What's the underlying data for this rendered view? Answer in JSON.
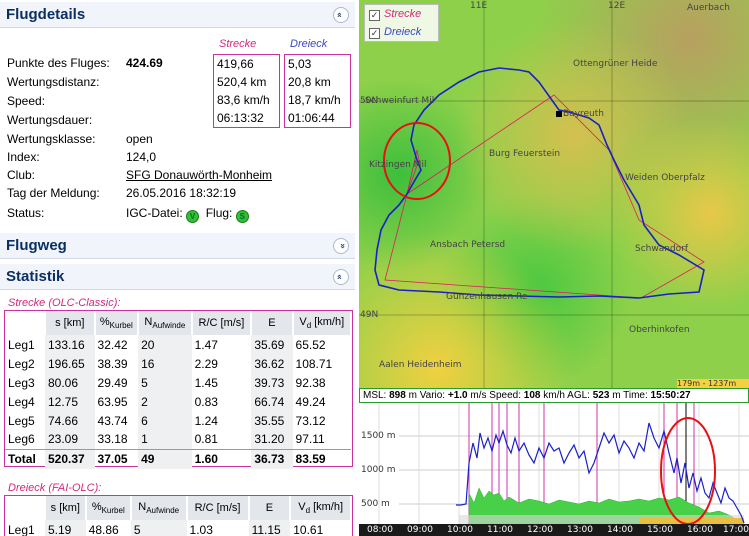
{
  "sections": {
    "flugdetails": "Flugdetails",
    "flugweg": "Flugweg",
    "statistik": "Statistik",
    "toggle_up": "»",
    "toggle_down": "»"
  },
  "details": {
    "labels": [
      "Punkte des Fluges:",
      "Wertungsdistanz:",
      "Speed:",
      "Wertungsdauer:",
      "Wertungsklasse:",
      "Index:",
      "Club:",
      "Tag der Meldung:",
      "Status:"
    ],
    "punkte": "424.69",
    "wertungsklasse": "open",
    "index": "124,0",
    "club": "SFG Donauwörth-Monheim",
    "tag": "26.05.2016 18:32:19",
    "igc_label": "IGC-Datei:",
    "flug_label": "Flug:",
    "igc_icon": "V",
    "flug_icon": "S"
  },
  "strecke": {
    "header": "Strecke",
    "values": [
      "419,66",
      "520,4 km",
      "83,6 km/h",
      "06:13:32"
    ]
  },
  "dreieck": {
    "header": "Dreieck",
    "values": [
      "5,03",
      "20,8 km",
      "18,7 km/h",
      "01:06:44"
    ]
  },
  "stats_olc": {
    "title": "Strecke (OLC-Classic):",
    "headers": [
      "",
      "s [km]",
      "%Kurbel",
      "NAufwinde",
      "R/C [m/s]",
      "E",
      "Vd [km/h]"
    ],
    "rows": [
      [
        "Leg1",
        "133.16",
        "32.42",
        "20",
        "1.47",
        "35.69",
        "65.52"
      ],
      [
        "Leg2",
        "196.65",
        "38.39",
        "16",
        "2.29",
        "36.62",
        "108.71"
      ],
      [
        "Leg3",
        "80.06",
        "29.49",
        "5",
        "1.45",
        "39.73",
        "92.38"
      ],
      [
        "Leg4",
        "12.75",
        "63.95",
        "2",
        "0.83",
        "66.74",
        "49.24"
      ],
      [
        "Leg5",
        "74.66",
        "43.74",
        "6",
        "1.24",
        "35.55",
        "73.12"
      ],
      [
        "Leg6",
        "23.09",
        "33.18",
        "1",
        "0.81",
        "31.20",
        "97.11"
      ]
    ],
    "total": [
      "Total",
      "520.37",
      "37.05",
      "49",
      "1.60",
      "36.73",
      "83.59"
    ]
  },
  "stats_fai": {
    "title": "Dreieck (FAI-OLC):",
    "rows": [
      [
        "Leg1",
        "5.19",
        "48.86",
        "5",
        "1.03",
        "11.15",
        "10.61"
      ]
    ]
  },
  "map": {
    "legend": [
      "Strecke",
      "Dreieck"
    ],
    "checkmark": "✓",
    "labels": {
      "grid11e": "11E",
      "grid12e": "12E",
      "grid50n": "50N",
      "grid49n": "49N",
      "auerbach": "Auerbach",
      "ottengruener": "Ottengrüner Heide",
      "schweinfurt": "Schweinfurt Mil",
      "bayreuth": "Bayreuth",
      "kitzingen": "Kitzingen Mil",
      "burg": "Burg Feuerstein",
      "weiden": "Weiden Oberpfalz",
      "ansbach": "Ansbach Petersd",
      "schwandorf": "Schwandorf",
      "gunzenhausen": "Gunzenhausen Re",
      "oberhinkofen": "Oberhinkofen",
      "aalen": "Aalen Heidenheim"
    },
    "scale": "179m - 1237m"
  },
  "infobar": {
    "msl_label": "MSL:",
    "msl": "898",
    "vario_label": "m Vario:",
    "vario": "+1.0",
    "speed_label": "m/s Speed:",
    "speed": "108",
    "agl_label": "km/h AGL:",
    "agl": "523",
    "time_label": "m Time:",
    "time": "15:50:27"
  },
  "barogram": {
    "yticks": [
      "1500 m",
      "1000 m",
      "500 m"
    ],
    "xticks": [
      "08:00",
      "09:00",
      "10:00",
      "11:00",
      "12:00",
      "13:00",
      "14:00",
      "15:00",
      "16:00",
      "17:00"
    ]
  }
}
